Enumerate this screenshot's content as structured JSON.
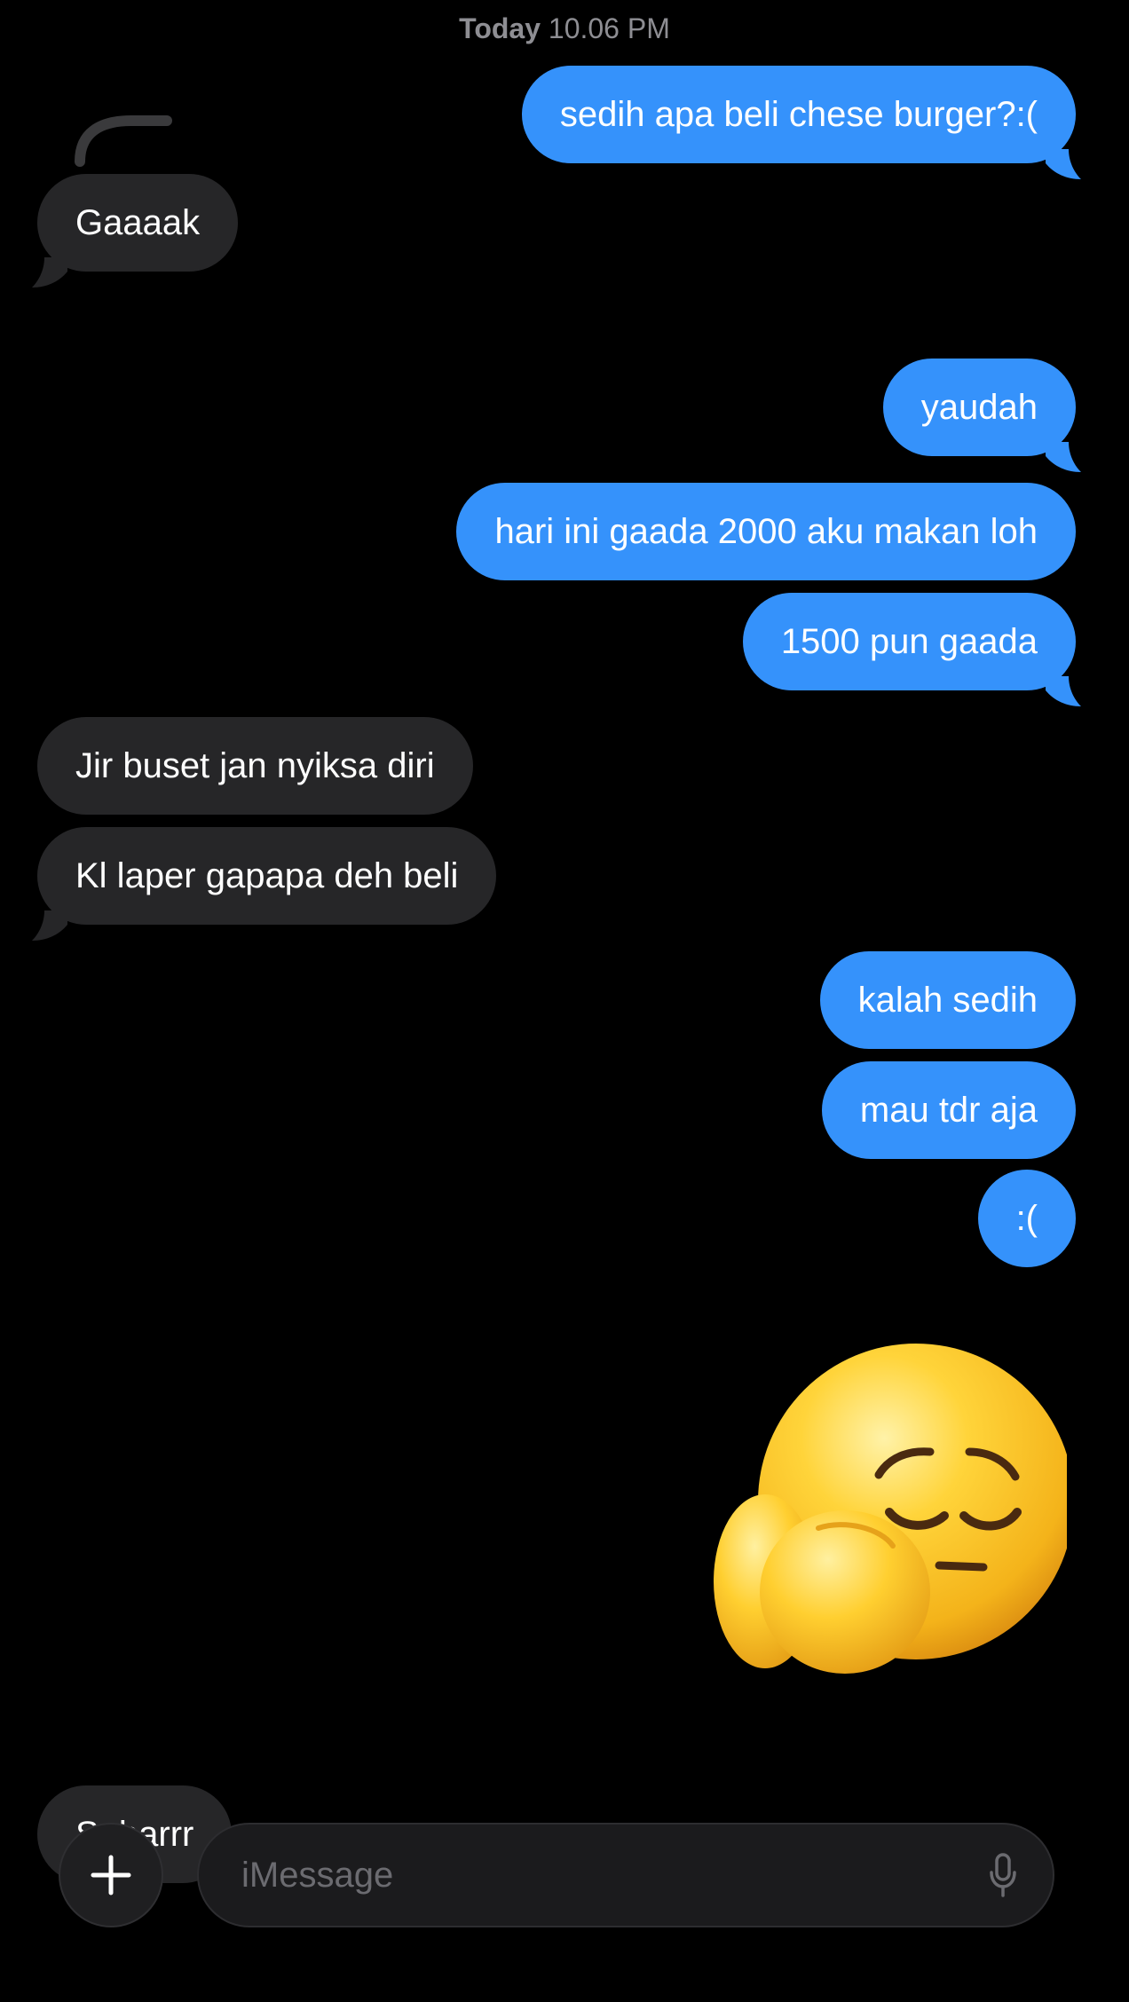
{
  "header": {
    "timestamp_day": "Today",
    "timestamp_time": "10.06 PM"
  },
  "messages": [
    {
      "side": "out",
      "text": "sedih apa beli chese burger?:("
    },
    {
      "side": "in",
      "text": "Gaaaak"
    },
    {
      "side": "out",
      "text": "yaudah"
    },
    {
      "side": "out",
      "text": "hari ini gaada 2000 aku makan loh"
    },
    {
      "side": "out",
      "text": "1500 pun gaada"
    },
    {
      "side": "in",
      "text": "Jir buset jan nyiksa diri"
    },
    {
      "side": "in",
      "text": "Kl laper gapapa deh beli"
    },
    {
      "side": "out",
      "text": "kalah sedih"
    },
    {
      "side": "out",
      "text": "mau tdr aja"
    },
    {
      "side": "out",
      "text": ":("
    },
    {
      "side": "out",
      "type": "sticker",
      "icon": "pensive-emoji-sticker"
    },
    {
      "side": "in",
      "text": "Sabarrr"
    }
  ],
  "composer": {
    "placeholder": "iMessage",
    "plus_icon": "plus-icon",
    "mic_icon": "microphone-icon"
  },
  "colors": {
    "outgoing": "#3592fb",
    "incoming": "#262628",
    "background": "#000000"
  }
}
